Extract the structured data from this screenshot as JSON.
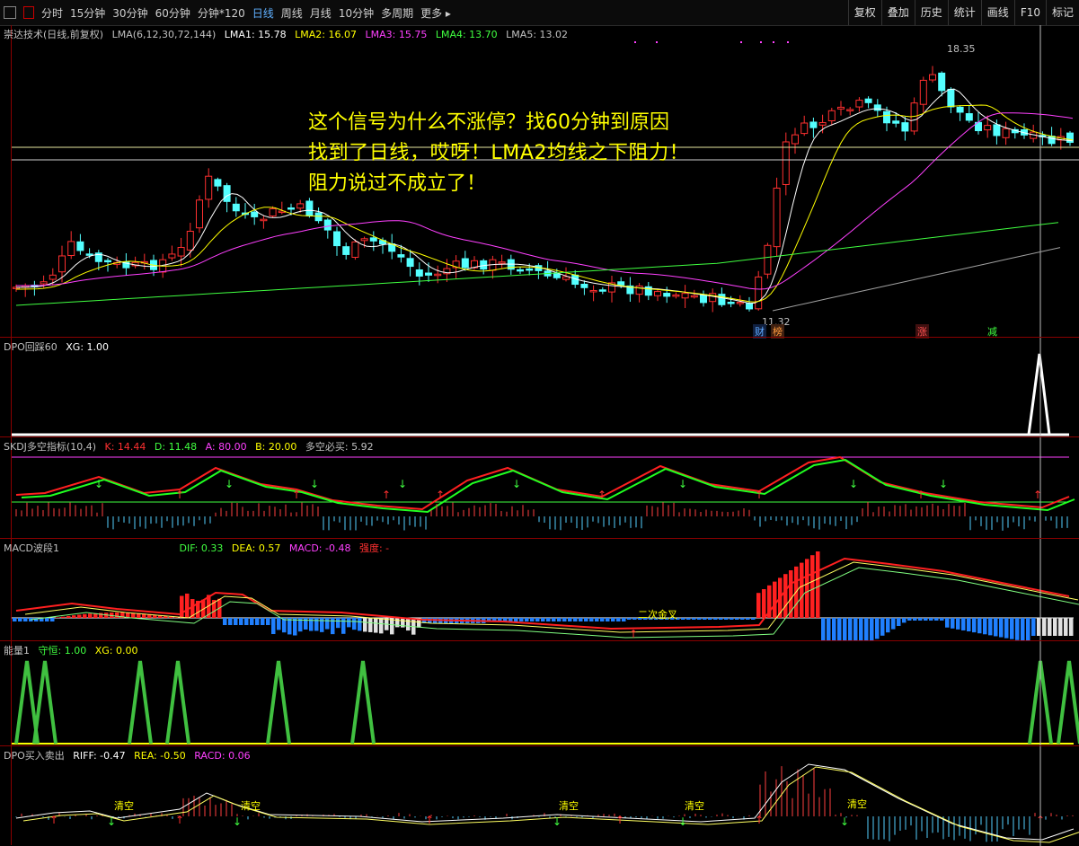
{
  "toolbar": {
    "periods": [
      "分时",
      "15分钟",
      "30分钟",
      "60分钟",
      "分钟*120",
      "日线",
      "周线",
      "月线",
      "10分钟",
      "多周期",
      "更多 ▸"
    ],
    "active_period": "日线",
    "buttons": [
      "复权",
      "叠加",
      "历史",
      "统计",
      "画线",
      "F10",
      "标记"
    ]
  },
  "main": {
    "title": "崇达技术(日线,前复权)",
    "indicator": "LMA(6,12,30,72,144)",
    "lma": [
      {
        "label": "LMA1: 15.78",
        "color": "#ffffff"
      },
      {
        "label": "LMA2: 16.07",
        "color": "#ffff00"
      },
      {
        "label": "LMA3: 15.75",
        "color": "#ff40ff"
      },
      {
        "label": "LMA4: 13.70",
        "color": "#40ff40"
      },
      {
        "label": "LMA5: 13.02",
        "color": "#c0c0c0"
      }
    ],
    "annotation": [
      "这个信号为什么不涨停？找60分钟到原因",
      "找到了日线，哎呀！LMA2均线之下阻力！",
      "阻力说过不成立了！"
    ],
    "high_label": "18.35",
    "low_label": "11.32",
    "tags": [
      {
        "text": "财",
        "color": "#5fa8ff"
      },
      {
        "text": "榜",
        "color": "#ff9a3c"
      },
      {
        "text": "涨",
        "color": "#ff4040"
      },
      {
        "text": "减",
        "color": "#40ff40"
      }
    ]
  },
  "dpo60": {
    "title": "DPO回踩60",
    "xg": "XG: 1.00"
  },
  "skdj": {
    "title": "SKDJ多空指标(10,4)",
    "k": "K: 14.44",
    "d": "D: 11.48",
    "a": "A: 80.00",
    "b": "B: 20.00",
    "dk": "多空必买: 5.92"
  },
  "macd": {
    "title": "MACD波段1",
    "dif": "DIF: 0.33",
    "dea": "DEA: 0.57",
    "macd": "MACD: -0.48",
    "qd": "强度: -",
    "cross_label": "二次金叉"
  },
  "energy": {
    "title": "能量1",
    "sh": "守恒: 1.00",
    "xg": "XG: 0.00"
  },
  "dpobs": {
    "title": "DPO买入卖出",
    "riff": "RIFF: -0.47",
    "rea": "REA: -0.50",
    "racd": "RACD: 0.06",
    "clear_label": "清空"
  }
}
